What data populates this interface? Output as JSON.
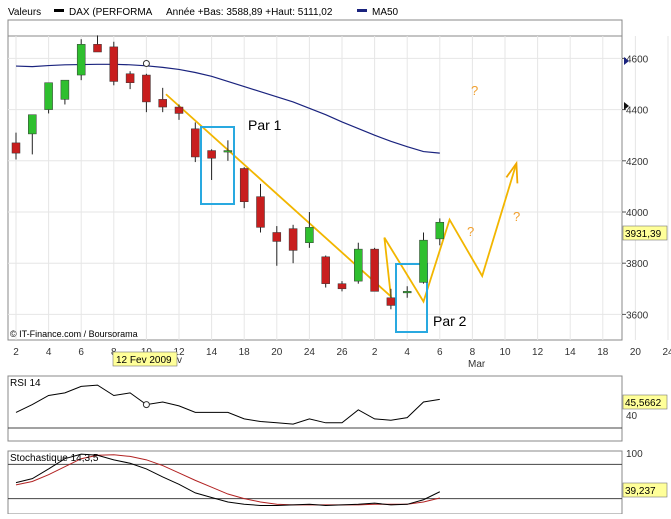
{
  "header": {
    "title": "Valeurs",
    "instrument": "DAX (PERFORMA",
    "stats": "Année +Bas: 3588,89 +Haut: 5111,02",
    "ma_label": "MA50"
  },
  "copyright": "© IT-Finance.com / Boursorama",
  "date_badge": "12 Fev 2009",
  "month_label": "Mar",
  "clipped_label": "v",
  "colors": {
    "up": "#2fbf2f",
    "down": "#c81e1e",
    "ma": "#1a237e",
    "annotation_line": "#f2b600",
    "annotation_arrow": "#f0a800",
    "box": "#29a9e0",
    "price_badge_bg": "#ffff99",
    "rsi": "#000000",
    "stoch_k": "#000000",
    "stoch_d": "#b22222"
  },
  "chart_data": {
    "type": "candlestick",
    "x_ticks": [
      "2",
      "4",
      "6",
      "8",
      "10",
      "12",
      "14",
      "18",
      "20",
      "24",
      "26",
      "2",
      "4",
      "6",
      "8",
      "10",
      "12",
      "14",
      "18",
      "20",
      "24"
    ],
    "y_ticks": [
      3600,
      3800,
      4000,
      4200,
      4400,
      4600
    ],
    "y_range": [
      3500,
      4750
    ],
    "last_price": "3931,39",
    "candles": [
      {
        "o": 4270,
        "h": 4310,
        "l": 4205,
        "c": 4230
      },
      {
        "o": 4305,
        "h": 4340,
        "l": 4225,
        "c": 4380
      },
      {
        "o": 4400,
        "h": 4490,
        "l": 4385,
        "c": 4505
      },
      {
        "o": 4440,
        "h": 4505,
        "l": 4420,
        "c": 4515
      },
      {
        "o": 4535,
        "h": 4675,
        "l": 4515,
        "c": 4655
      },
      {
        "o": 4655,
        "h": 4690,
        "l": 4635,
        "c": 4625
      },
      {
        "o": 4645,
        "h": 4665,
        "l": 4495,
        "c": 4510
      },
      {
        "o": 4540,
        "h": 4550,
        "l": 4480,
        "c": 4505
      },
      {
        "o": 4535,
        "h": 4540,
        "l": 4390,
        "c": 4430
      },
      {
        "o": 4440,
        "h": 4485,
        "l": 4390,
        "c": 4410
      },
      {
        "o": 4410,
        "h": 4420,
        "l": 4360,
        "c": 4385
      },
      {
        "o": 4325,
        "h": 4350,
        "l": 4195,
        "c": 4215
      },
      {
        "o": 4240,
        "h": 4245,
        "l": 4125,
        "c": 4210
      },
      {
        "o": 4240,
        "h": 4280,
        "l": 4200,
        "c": 4240
      },
      {
        "o": 4170,
        "h": 4175,
        "l": 4015,
        "c": 4040
      },
      {
        "o": 4060,
        "h": 4110,
        "l": 3920,
        "c": 3940
      },
      {
        "o": 3920,
        "h": 3945,
        "l": 3790,
        "c": 3885
      },
      {
        "o": 3935,
        "h": 3950,
        "l": 3800,
        "c": 3850
      },
      {
        "o": 3880,
        "h": 4000,
        "l": 3860,
        "c": 3940
      },
      {
        "o": 3825,
        "h": 3830,
        "l": 3705,
        "c": 3720
      },
      {
        "o": 3720,
        "h": 3730,
        "l": 3690,
        "c": 3700
      },
      {
        "o": 3730,
        "h": 3880,
        "l": 3720,
        "c": 3855
      },
      {
        "o": 3855,
        "h": 3860,
        "l": 3700,
        "c": 3690
      },
      {
        "o": 3665,
        "h": 3700,
        "l": 3620,
        "c": 3635
      },
      {
        "o": 3685,
        "h": 3710,
        "l": 3665,
        "c": 3690
      },
      {
        "o": 3725,
        "h": 3920,
        "l": 3720,
        "c": 3890
      },
      {
        "o": 3895,
        "h": 3975,
        "l": 3870,
        "c": 3960
      }
    ],
    "ma50": [
      4570,
      4568,
      4572,
      4575,
      4576,
      4577,
      4577,
      4575,
      4571,
      4565,
      4557,
      4545,
      4530,
      4510,
      4490,
      4470,
      4450,
      4430,
      4405,
      4380,
      4352,
      4326,
      4300,
      4276,
      4255,
      4236,
      4230
    ],
    "annotations": {
      "labels": [
        "Par 1",
        "Par 2"
      ],
      "question_marks": [
        "?",
        "?",
        "?"
      ]
    },
    "rsi": {
      "label": "RSI 14",
      "y_ticks": [
        40
      ],
      "value_label": "45,5662",
      "values": [
        42,
        48,
        55,
        57,
        62,
        63,
        55,
        57,
        48,
        50,
        47,
        42,
        42,
        42,
        37,
        35,
        34,
        33,
        37,
        34,
        34,
        44,
        37,
        36,
        38,
        50,
        52
      ]
    },
    "stochastic": {
      "label": "Stochastique 14,3,5",
      "y_ticks": [
        100
      ],
      "value_label": "39,237",
      "k": [
        48,
        55,
        72,
        90,
        98,
        96,
        88,
        82,
        72,
        58,
        45,
        30,
        22,
        14,
        10,
        8,
        8,
        9,
        10,
        8,
        9,
        10,
        12,
        9,
        10,
        18,
        32
      ],
      "d": [
        44,
        50,
        62,
        76,
        90,
        96,
        97,
        94,
        88,
        78,
        65,
        52,
        40,
        28,
        20,
        14,
        10,
        9,
        9,
        9,
        9,
        9,
        10,
        10,
        10,
        14,
        21
      ]
    }
  }
}
